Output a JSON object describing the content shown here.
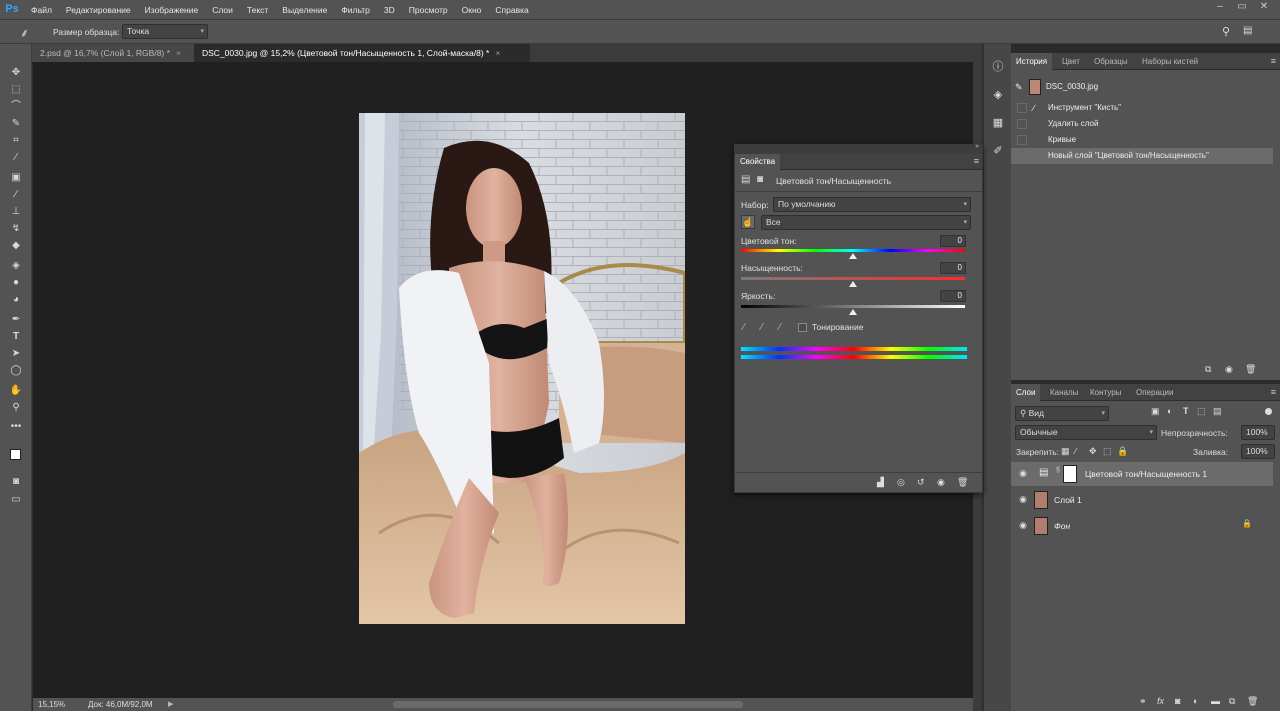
{
  "menubar": {
    "logo": "Ps",
    "items": [
      "Файл",
      "Редактирование",
      "Изображение",
      "Слои",
      "Текст",
      "Выделение",
      "Фильтр",
      "3D",
      "Просмотр",
      "Окно",
      "Справка"
    ]
  },
  "options": {
    "sample_label": "Размер образца:",
    "sample_value": "Точка"
  },
  "tabs": [
    {
      "label": "2.psd @ 16,7% (Слой 1, RGB/8) *",
      "active": false
    },
    {
      "label": "DSC_0030.jpg @ 15,2% (Цветовой тон/Насыщенность 1, Слой-маска/8) *",
      "active": true
    }
  ],
  "status": {
    "zoom": "15,15%",
    "doc": "Док: 46,0M/92,0M"
  },
  "history_panel": {
    "tabs": [
      "История",
      "Цвет",
      "Образцы",
      "Наборы кистей"
    ],
    "snapshot": "DSC_0030.jpg",
    "items": [
      "Инструмент \"Кисть\"",
      "Удалить слой",
      "Кривые",
      "Новый слой \"Цветовой тон/Насыщенность\""
    ]
  },
  "properties": {
    "title": "Свойства",
    "adjustment": "Цветовой тон/Насыщенность",
    "preset_label": "Набор:",
    "preset_value": "По умолчанию",
    "channel_value": "Все",
    "hue_label": "Цветовой тон:",
    "hue_value": "0",
    "sat_label": "Насыщенность:",
    "sat_value": "0",
    "light_label": "Яркость:",
    "light_value": "0",
    "colorize_label": "Тонирование"
  },
  "layers_panel": {
    "tabs": [
      "Слои",
      "Каналы",
      "Контуры",
      "Операции"
    ],
    "filter_label": "Вид",
    "blend_mode": "Обычные",
    "opacity_label": "Непрозрачность:",
    "opacity_value": "100%",
    "lock_label": "Закрепить:",
    "fill_label": "Заливка:",
    "fill_value": "100%",
    "layers": [
      "Цветовой тон/Насыщенность 1",
      "Слой 1",
      "Фон"
    ]
  }
}
